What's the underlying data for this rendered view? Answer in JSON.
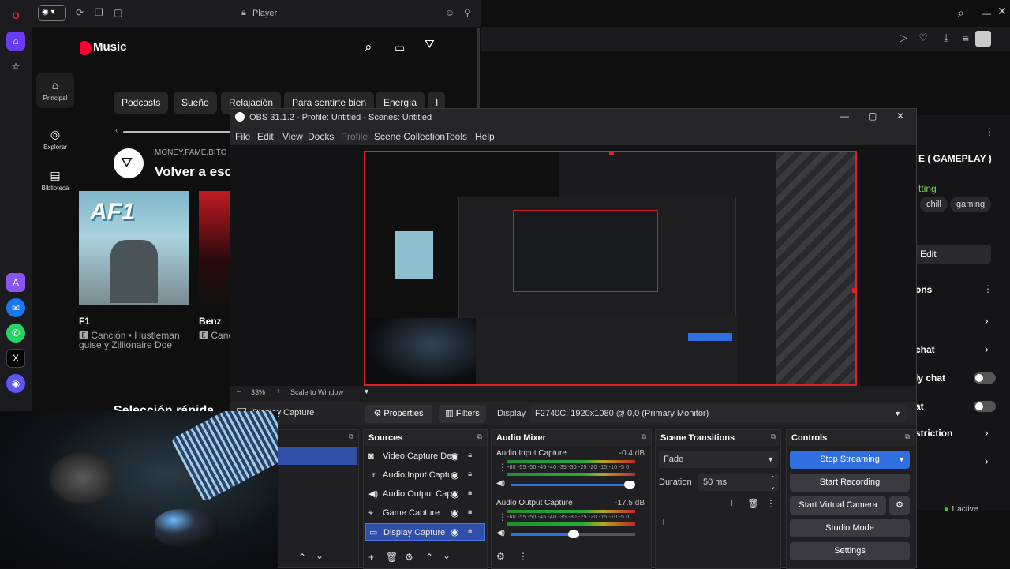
{
  "browser": {
    "yt_tab_title": "Player",
    "right_window": {
      "video_title_fragment": "E ( GAMEPLAY )",
      "category_fragment": "tting",
      "tags": [
        "chill",
        "gaming"
      ],
      "edit_fragment": "Edit",
      "section_fragment": "ons",
      "rows": [
        "chat",
        "ly chat",
        "at",
        "striction",
        ""
      ],
      "active_label": "1 active"
    }
  },
  "youtube": {
    "logo_text": "Music",
    "rail": [
      {
        "label": "Principal",
        "icon": "home-icon"
      },
      {
        "label": "Explorar",
        "icon": "compass-icon"
      },
      {
        "label": "Biblioteca",
        "icon": "library-icon"
      }
    ],
    "chips": [
      "Podcasts",
      "Sueño",
      "Relajación",
      "Para sentirte bien",
      "Energía",
      "I"
    ],
    "channel_name": "MONEY.FAME.BITC",
    "section_title": "Volver a esc",
    "cards": [
      {
        "art_text": "AF1",
        "title": "F1",
        "sub1": "Canción • Hustleman",
        "sub2": "guise y Zillionaire Doe"
      },
      {
        "title": "Benz",
        "sub1": "Canc"
      }
    ],
    "quick_select": "Selección rápida"
  },
  "obs": {
    "title": "OBS 31.1.2 - Profile: Untitled - Scenes: Untitled",
    "menu": [
      "File",
      "Edit",
      "View",
      "Docks",
      "Profile",
      "Scene Collection",
      "Tools",
      "Help"
    ],
    "zoom": "33%",
    "scale_mode": "Scale to Window",
    "source_label": "Display Capture",
    "properties_label": "Properties",
    "filters_label": "Filters",
    "display_label": "Display",
    "display_value": "F2740C: 1920x1080 @ 0,0 (Primary Monitor)",
    "docks": {
      "sources": {
        "title": "Sources",
        "items": [
          "Video Capture Dev",
          "Audio Input Captu",
          "Audio Output Cap",
          "Game Capture",
          "Display Capture"
        ]
      },
      "mixer": {
        "title": "Audio Mixer",
        "channels": [
          {
            "name": "Audio Input Capture",
            "db": "-0.4 dB",
            "volume": 1.0
          },
          {
            "name": "Audio Output Capture",
            "db": "-17.5 dB",
            "volume": 0.55
          }
        ],
        "ticks": "-60 -55 -50 -45 -40 -35 -30 -25 -20 -15 -10 -5 0"
      },
      "transitions": {
        "title": "Scene Transitions",
        "selected": "Fade",
        "duration_label": "Duration",
        "duration_value": "50 ms"
      },
      "controls": {
        "title": "Controls",
        "stop_streaming": "Stop Streaming",
        "start_recording": "Start Recording",
        "start_virtual_camera": "Start Virtual Camera",
        "studio_mode": "Studio Mode",
        "settings": "Settings"
      }
    }
  },
  "colors": {
    "accent_blue": "#2f6fe0",
    "preview_border": "#dd2222",
    "yt_red": "#ff0033"
  }
}
